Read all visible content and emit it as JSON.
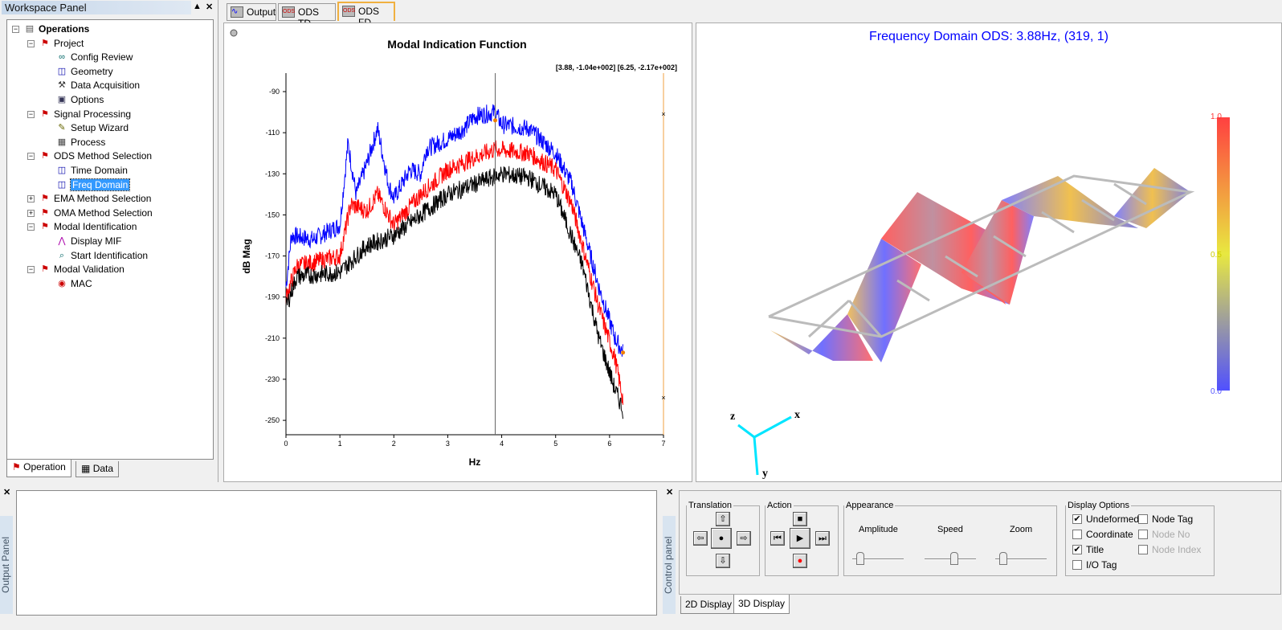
{
  "workspace": {
    "title": "Workspace Panel",
    "pin": "▲",
    "close": "✕",
    "tree": [
      {
        "label": "Operations",
        "level": 0,
        "bold": true,
        "exp": "−",
        "icon": "operations-icon"
      },
      {
        "label": "Project",
        "level": 1,
        "exp": "−",
        "icon": "runner-icon"
      },
      {
        "label": "Config Review",
        "level": 2,
        "icon": "glasses-icon"
      },
      {
        "label": "Geometry",
        "level": 2,
        "icon": "geometry-icon"
      },
      {
        "label": "Data Acquisition",
        "level": 2,
        "icon": "hammer-icon"
      },
      {
        "label": "Options",
        "level": 2,
        "icon": "options-icon"
      },
      {
        "label": "Signal Processing",
        "level": 1,
        "exp": "−",
        "icon": "runner-icon"
      },
      {
        "label": "Setup Wizard",
        "level": 2,
        "icon": "wizard-icon"
      },
      {
        "label": "Process",
        "level": 2,
        "icon": "process-icon"
      },
      {
        "label": "ODS Method Selection",
        "level": 1,
        "exp": "−",
        "icon": "runner-icon"
      },
      {
        "label": "Time Domain",
        "level": 2,
        "icon": "geometry-icon"
      },
      {
        "label": "Freq Domain",
        "level": 2,
        "icon": "geometry-icon",
        "selected": true
      },
      {
        "label": "EMA Method Selection",
        "level": 1,
        "exp": "+",
        "icon": "runner-icon"
      },
      {
        "label": "OMA Method Selection",
        "level": 1,
        "exp": "+",
        "icon": "runner-icon"
      },
      {
        "label": "Modal Identification",
        "level": 1,
        "exp": "−",
        "icon": "runner-icon"
      },
      {
        "label": "Display MIF",
        "level": 2,
        "icon": "mif-icon"
      },
      {
        "label": "Start Identification",
        "level": 2,
        "icon": "identify-icon"
      },
      {
        "label": "Modal Validation",
        "level": 1,
        "exp": "−",
        "icon": "runner-icon"
      },
      {
        "label": "MAC",
        "level": 2,
        "icon": "mac-icon"
      }
    ],
    "bottom_tabs": [
      "Operation",
      "Data"
    ]
  },
  "doc_tabs": [
    {
      "label": "Output",
      "icon": "wave-icon"
    },
    {
      "label": "ODS TD",
      "icon": "ods-icon"
    },
    {
      "label": "ODS FD",
      "icon": "ods-icon",
      "active": true
    }
  ],
  "chart_data": {
    "type": "line",
    "title": "Modal Indication Function",
    "xlabel": "Hz",
    "ylabel": "dB Mag",
    "cursor_readout": "[3.88, -1.04e+002] [6.25, -2.17e+002]",
    "xlim": [
      0,
      7
    ],
    "ylim": [
      -257,
      -81
    ],
    "xticks": [
      0,
      1,
      2,
      3,
      4,
      5,
      6,
      7
    ],
    "yticks": [
      -90,
      -110,
      -130,
      -150,
      -170,
      -190,
      -210,
      -230,
      -250
    ],
    "cursors": [
      {
        "x": 3.88,
        "y": -104
      },
      {
        "x": 6.25,
        "y": -217
      }
    ],
    "right_markers": [
      {
        "x": 7,
        "y": -101
      },
      {
        "x": 7,
        "y": -239
      }
    ],
    "grid": false,
    "series": [
      {
        "color": "#0000ff",
        "points": [
          [
            0,
            -185
          ],
          [
            0.1,
            -160
          ],
          [
            0.5,
            -162
          ],
          [
            1.0,
            -155
          ],
          [
            1.15,
            -115
          ],
          [
            1.3,
            -140
          ],
          [
            1.5,
            -125
          ],
          [
            1.7,
            -108
          ],
          [
            1.9,
            -135
          ],
          [
            2.0,
            -142
          ],
          [
            2.3,
            -128
          ],
          [
            2.5,
            -130
          ],
          [
            2.6,
            -118
          ],
          [
            3.0,
            -113
          ],
          [
            3.3,
            -108
          ],
          [
            3.5,
            -102
          ],
          [
            3.88,
            -100
          ],
          [
            4.0,
            -106
          ],
          [
            4.5,
            -108
          ],
          [
            5.0,
            -120
          ],
          [
            5.3,
            -135
          ],
          [
            5.5,
            -155
          ],
          [
            5.8,
            -185
          ],
          [
            6.1,
            -210
          ],
          [
            6.25,
            -217
          ]
        ]
      },
      {
        "color": "#ff0000",
        "points": [
          [
            0,
            -190
          ],
          [
            0.2,
            -175
          ],
          [
            1.0,
            -170
          ],
          [
            1.2,
            -145
          ],
          [
            1.5,
            -148
          ],
          [
            1.7,
            -140
          ],
          [
            2.0,
            -155
          ],
          [
            2.5,
            -140
          ],
          [
            3.0,
            -128
          ],
          [
            3.5,
            -122
          ],
          [
            3.88,
            -118
          ],
          [
            4.5,
            -120
          ],
          [
            5.0,
            -128
          ],
          [
            5.3,
            -145
          ],
          [
            5.5,
            -165
          ],
          [
            5.8,
            -195
          ],
          [
            6.1,
            -220
          ],
          [
            6.25,
            -240
          ]
        ]
      },
      {
        "color": "#000000",
        "points": [
          [
            0,
            -195
          ],
          [
            0.2,
            -180
          ],
          [
            1.0,
            -178
          ],
          [
            1.5,
            -165
          ],
          [
            2.0,
            -160
          ],
          [
            2.5,
            -150
          ],
          [
            3.0,
            -140
          ],
          [
            3.5,
            -135
          ],
          [
            4.0,
            -130
          ],
          [
            4.5,
            -132
          ],
          [
            5.0,
            -140
          ],
          [
            5.5,
            -175
          ],
          [
            5.8,
            -210
          ],
          [
            6.1,
            -235
          ],
          [
            6.25,
            -245
          ]
        ]
      }
    ]
  },
  "view3d": {
    "title": "Frequency Domain ODS: 3.88Hz, (319, 1)",
    "title_color": "#0000ff",
    "colorbar": {
      "max": "1.0",
      "mid": "0.5",
      "min": "0.0"
    },
    "axes": {
      "x": "x",
      "y": "y",
      "z": "z"
    }
  },
  "output_panel": {
    "label": "Output Panel",
    "close": "✕"
  },
  "control": {
    "label": "Control panel",
    "close": "✕",
    "translation": {
      "title": "Translation"
    },
    "action": {
      "title": "Action"
    },
    "appearance": {
      "title": "Appearance",
      "sliders": [
        {
          "label": "Amplitude",
          "value": 0.1
        },
        {
          "label": "Speed",
          "value": 0.6
        },
        {
          "label": "Zoom",
          "value": 0.1
        }
      ]
    },
    "display": {
      "title": "Display Options",
      "options": [
        {
          "label": "Undeformed",
          "checked": true,
          "enabled": true
        },
        {
          "label": "Coordinate",
          "checked": false,
          "enabled": true
        },
        {
          "label": "Title",
          "checked": true,
          "enabled": true
        },
        {
          "label": "I/O Tag",
          "checked": false,
          "enabled": true
        },
        {
          "label": "Node Tag",
          "checked": false,
          "enabled": true
        },
        {
          "label": "Node No",
          "checked": false,
          "enabled": false
        },
        {
          "label": "Node Index",
          "checked": false,
          "enabled": false
        }
      ]
    },
    "tabs": [
      "2D Display",
      "3D Display"
    ]
  }
}
